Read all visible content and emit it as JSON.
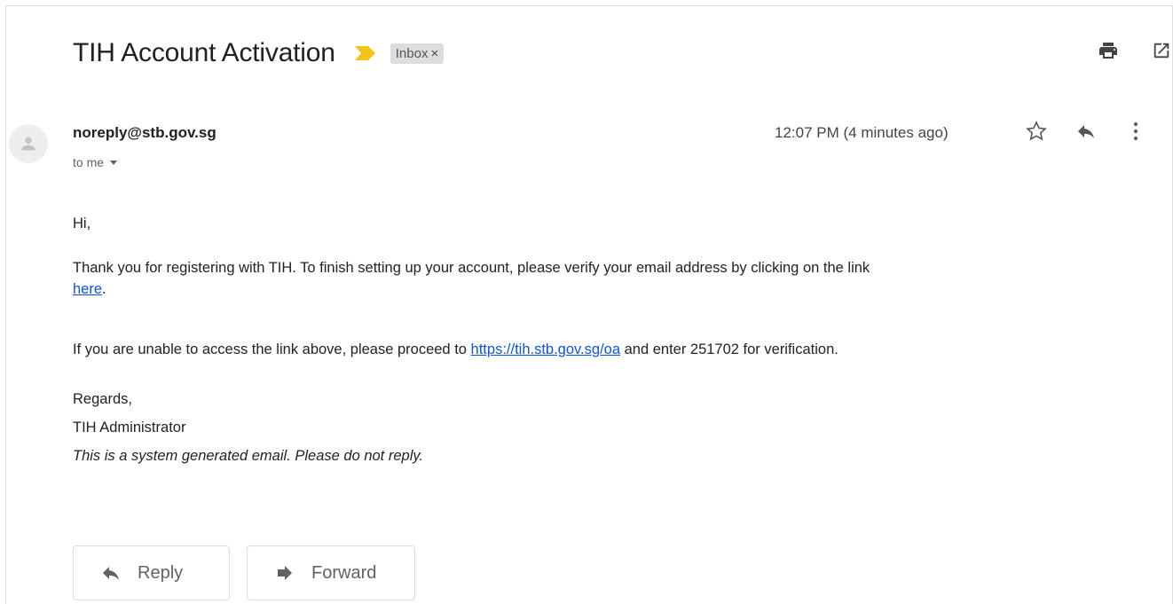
{
  "email": {
    "subject": "TIH Account Activation",
    "label": "Inbox",
    "label_close": "×",
    "sender": "noreply@stb.gov.sg",
    "recipient": "to me",
    "timestamp": "12:07 PM (4 minutes ago)"
  },
  "body": {
    "greeting": "Hi,",
    "line1_before": "Thank you for registering with TIH. To finish setting up your account, please verify your email address by clicking on the link",
    "line1_link": "here",
    "line1_after": ".",
    "line2_before": "If you are unable to access the link above, please proceed to ",
    "line2_link": "https://tih.stb.gov.sg/oa",
    "line2_after": " and enter 251702 for verification.",
    "regards": "Regards,",
    "signature": "TIH Administrator",
    "disclaimer": "This is a system generated email. Please do not reply."
  },
  "actions": {
    "reply_label": "Reply",
    "forward_label": "Forward"
  },
  "icons": {
    "importance": "importance-marker-icon",
    "print": "print-icon",
    "open_new_window": "open-in-new-window-icon",
    "avatar": "default-avatar-icon",
    "star": "star-icon",
    "reply": "reply-icon",
    "more": "more-vert-icon",
    "dropdown": "caret-down-icon",
    "forward": "forward-icon"
  },
  "colors": {
    "importance": "#f2c31c",
    "link": "#1155cc",
    "icon": "#5f6368"
  }
}
